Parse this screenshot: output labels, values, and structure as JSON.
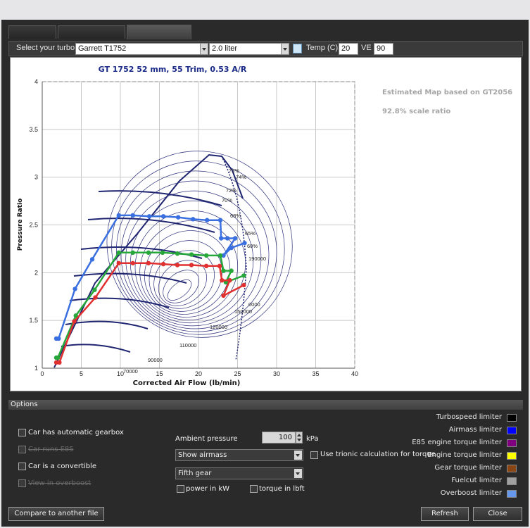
{
  "toolbar": {
    "select_turbo_label": "Select your turbo",
    "turbo_value": "Garrett T1752",
    "engine_size": "2.0 liter",
    "temp_label": "Temp (C)",
    "temp_value": "20",
    "ve_label": "VE",
    "ve_value": "90"
  },
  "tabs": [
    {
      "label": ""
    },
    {
      "label": ""
    },
    {
      "label": ""
    }
  ],
  "chart_notes": {
    "estimated": "Estimated Map based on GT2056",
    "scale": "92.8% scale ratio"
  },
  "chart_data": {
    "type": "line",
    "title": "GT  1752  52 mm, 55 Trim, 0.53 A/R",
    "xlabel": "Corrected Air Flow (lb/min)",
    "ylabel": "Pressure Ratio",
    "xlim": [
      0,
      40
    ],
    "ylim": [
      1,
      4
    ],
    "xticks": [
      "0",
      "5",
      "10",
      "15",
      "20",
      "25",
      "30",
      "35",
      "40"
    ],
    "yticks": [
      "1",
      "1.5",
      "2",
      "2.5",
      "3",
      "3.5",
      "4"
    ],
    "grid": true,
    "speed_labels": [
      "70000",
      "90000",
      "110000",
      "120000",
      "150000",
      "190000",
      "0000"
    ],
    "efficiency_labels": [
      "73%",
      "74%",
      "72%",
      "70%",
      "68%",
      "65%",
      "60%"
    ],
    "series": [
      {
        "color": "#3a6fe0",
        "points": [
          [
            1.8,
            1.31
          ],
          [
            2.1,
            1.31
          ],
          [
            4.2,
            1.83
          ],
          [
            6.4,
            2.14
          ],
          [
            9.8,
            2.6
          ],
          [
            11.6,
            2.6
          ],
          [
            13.7,
            2.59
          ],
          [
            15.5,
            2.59
          ],
          [
            17.4,
            2.58
          ],
          [
            19.3,
            2.56
          ],
          [
            21.1,
            2.55
          ],
          [
            22.8,
            2.55
          ],
          [
            22.9,
            2.36
          ],
          [
            23.7,
            2.36
          ],
          [
            24.7,
            2.36
          ],
          [
            23.2,
            2.18
          ],
          [
            24.2,
            2.26
          ],
          [
            25.9,
            2.31
          ]
        ]
      },
      {
        "color": "#27a83a",
        "points": [
          [
            1.8,
            1.11
          ],
          [
            2.0,
            1.11
          ],
          [
            4.3,
            1.55
          ],
          [
            6.7,
            1.82
          ],
          [
            9.8,
            2.21
          ],
          [
            11.6,
            2.21
          ],
          [
            13.6,
            2.21
          ],
          [
            15.4,
            2.21
          ],
          [
            17.3,
            2.2
          ],
          [
            19.1,
            2.19
          ],
          [
            21.0,
            2.18
          ],
          [
            22.8,
            2.18
          ],
          [
            23.2,
            2.02
          ],
          [
            24.2,
            2.02
          ],
          [
            23.5,
            1.9
          ],
          [
            25.8,
            1.97
          ]
        ]
      },
      {
        "color": "#e03030",
        "points": [
          [
            1.8,
            1.06
          ],
          [
            2.2,
            1.06
          ],
          [
            4.1,
            1.49
          ],
          [
            6.8,
            1.74
          ],
          [
            9.8,
            2.1
          ],
          [
            11.6,
            2.1
          ],
          [
            13.6,
            2.1
          ],
          [
            15.5,
            2.09
          ],
          [
            17.3,
            2.08
          ],
          [
            19.1,
            2.08
          ],
          [
            21.0,
            2.07
          ],
          [
            22.7,
            2.07
          ],
          [
            23.0,
            1.92
          ],
          [
            24.0,
            1.92
          ],
          [
            23.2,
            1.76
          ],
          [
            25.8,
            1.87
          ]
        ]
      }
    ]
  },
  "options": {
    "header": "Options",
    "automatic_gearbox": "Car has automatic gearbox",
    "runs_e85": "Car runs E85",
    "convertible": "Car is a convertible",
    "view_overboost": "View in overboost",
    "ambient_pressure_label": "Ambient pressure",
    "ambient_pressure_value": "100",
    "ambient_unit": "kPa",
    "airmass_select": "Show airmass",
    "gear_select": "Fifth gear",
    "trionic_label": "Use trionic calculation for torque",
    "power_kw": "power in kW",
    "torque_lbft": "torque in lbft"
  },
  "legend": [
    {
      "label": "Turbospeed limiter",
      "color": "#000000"
    },
    {
      "label": "Airmass limiter",
      "color": "#0000ff"
    },
    {
      "label": "E85 engine torque limiter",
      "color": "#800080"
    },
    {
      "label": "Engine torque limiter",
      "color": "#ffff00"
    },
    {
      "label": "Gear torque limiter",
      "color": "#8b4513"
    },
    {
      "label": "Fuelcut limiter",
      "color": "#a0a0a0"
    },
    {
      "label": "Overboost limiter",
      "color": "#6699ee"
    }
  ],
  "buttons": {
    "compare": "Compare to another file",
    "refresh": "Refresh",
    "close": "Close"
  }
}
